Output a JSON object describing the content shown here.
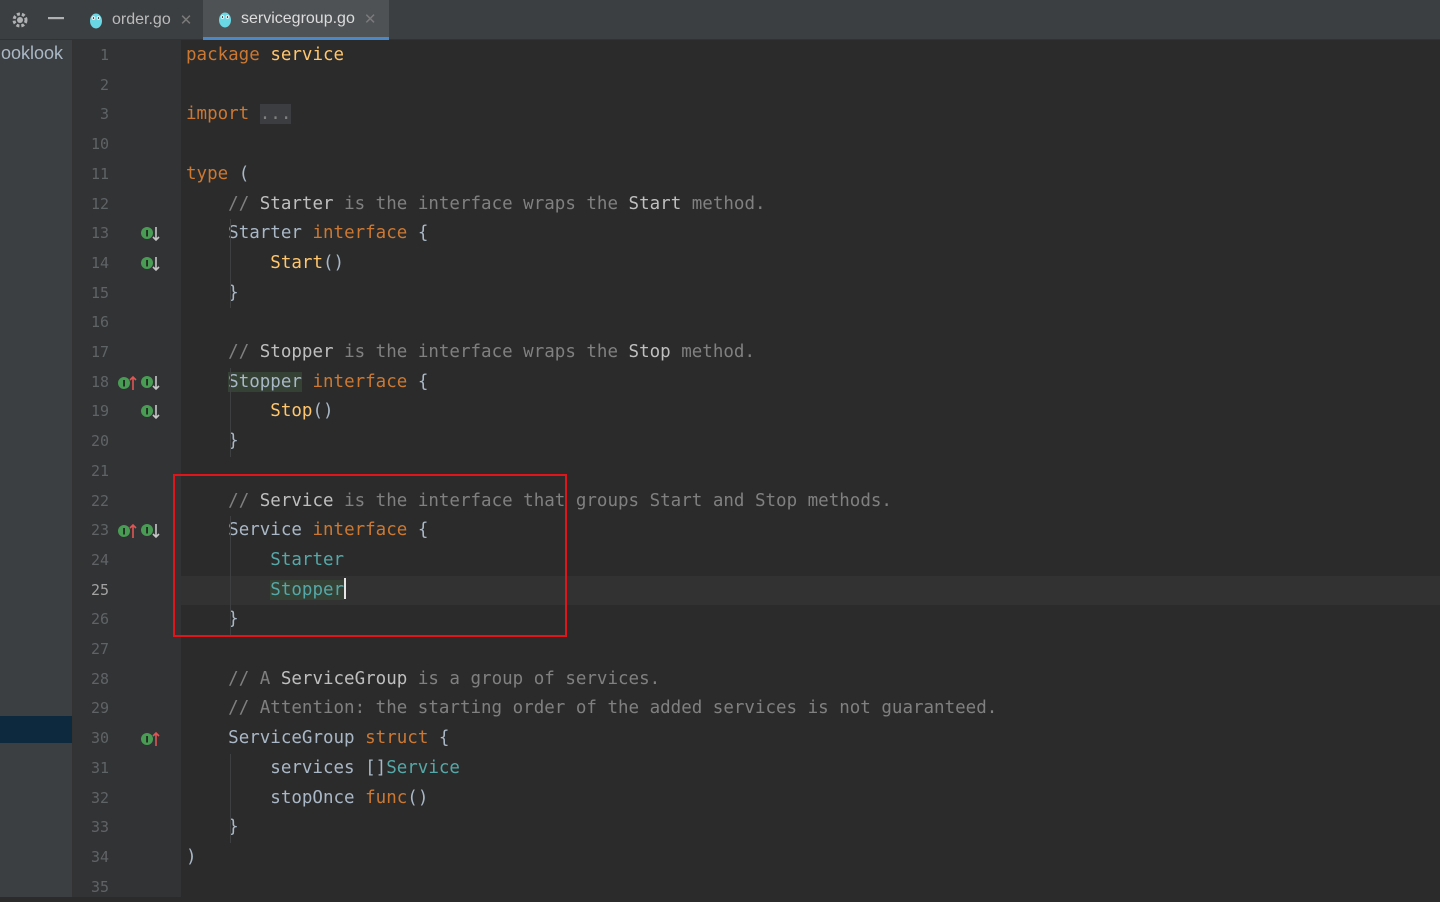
{
  "tabs": [
    {
      "label": "order.go",
      "active": false
    },
    {
      "label": "servicegroup.go",
      "active": true
    }
  ],
  "toolbar": {
    "gear_icon": "gear-icon",
    "minimize_icon": "minimize-icon"
  },
  "project_panel": {
    "visible_text": "ooklook"
  },
  "colors": {
    "keyword": "#cc7832",
    "comment": "#808080",
    "identifier": "#a9b7c6",
    "function": "#ffc66d",
    "type_ref": "#56a8a8",
    "highlight_box": "#e0141b",
    "current_line": "#323232"
  },
  "editor": {
    "current_line": 25,
    "lines": [
      {
        "num": "1",
        "tokens": [
          [
            "package",
            "kw"
          ],
          [
            " ",
            "pl"
          ],
          [
            "service",
            "fn"
          ]
        ]
      },
      {
        "num": "2",
        "tokens": []
      },
      {
        "num": "3",
        "tokens": [
          [
            "import",
            "kw"
          ],
          [
            " ",
            "pl"
          ],
          [
            "...",
            "fold"
          ]
        ]
      },
      {
        "num": "10",
        "tokens": []
      },
      {
        "num": "11",
        "tokens": [
          [
            "type",
            "kw"
          ],
          [
            " (",
            "pl"
          ]
        ]
      },
      {
        "num": "12",
        "tokens": [
          [
            "    ",
            "pl"
          ],
          [
            "// ",
            "cm"
          ],
          [
            "Starter",
            "cmb"
          ],
          [
            " is the interface wraps the ",
            "cm"
          ],
          [
            "Start",
            "cmb"
          ],
          [
            " method.",
            "cm"
          ]
        ]
      },
      {
        "num": "13",
        "marks": [
          "implemented"
        ],
        "tokens": [
          [
            "    ",
            "pl"
          ],
          [
            "Starter",
            "id"
          ],
          [
            " ",
            "pl"
          ],
          [
            "interface",
            "kw"
          ],
          [
            " {",
            "pl"
          ]
        ]
      },
      {
        "num": "14",
        "marks": [
          "implemented"
        ],
        "tokens": [
          [
            "        ",
            "pl"
          ],
          [
            "Start",
            "fn"
          ],
          [
            "()",
            "pl"
          ]
        ]
      },
      {
        "num": "15",
        "tokens": [
          [
            "    }",
            "pl"
          ]
        ]
      },
      {
        "num": "16",
        "tokens": []
      },
      {
        "num": "17",
        "tokens": [
          [
            "    ",
            "pl"
          ],
          [
            "// ",
            "cm"
          ],
          [
            "Stopper",
            "cmb"
          ],
          [
            " is the interface wraps the ",
            "cm"
          ],
          [
            "Stop",
            "cmb"
          ],
          [
            " method.",
            "cm"
          ]
        ]
      },
      {
        "num": "18",
        "marks": [
          "implements",
          "implemented"
        ],
        "tokens": [
          [
            "    ",
            "pl"
          ],
          [
            "Stopper",
            "hl"
          ],
          [
            " ",
            "pl"
          ],
          [
            "interface",
            "kw"
          ],
          [
            " {",
            "pl"
          ]
        ]
      },
      {
        "num": "19",
        "marks": [
          "implemented"
        ],
        "tokens": [
          [
            "        ",
            "pl"
          ],
          [
            "Stop",
            "fn"
          ],
          [
            "()",
            "pl"
          ]
        ]
      },
      {
        "num": "20",
        "tokens": [
          [
            "    }",
            "pl"
          ]
        ]
      },
      {
        "num": "21",
        "tokens": []
      },
      {
        "num": "22",
        "tokens": [
          [
            "    ",
            "pl"
          ],
          [
            "// ",
            "cm"
          ],
          [
            "Service",
            "cmb"
          ],
          [
            " is the interface that groups Start and Stop methods.",
            "cm"
          ]
        ]
      },
      {
        "num": "23",
        "marks": [
          "implements",
          "implemented"
        ],
        "tokens": [
          [
            "    ",
            "pl"
          ],
          [
            "Service",
            "id"
          ],
          [
            " ",
            "pl"
          ],
          [
            "interface",
            "kw"
          ],
          [
            " {",
            "pl"
          ]
        ]
      },
      {
        "num": "24",
        "tokens": [
          [
            "        ",
            "pl"
          ],
          [
            "Starter",
            "ty"
          ]
        ]
      },
      {
        "num": "25",
        "caret": true,
        "tokens": [
          [
            "        ",
            "pl"
          ],
          [
            "Stopper",
            "tyhl"
          ]
        ]
      },
      {
        "num": "26",
        "tokens": [
          [
            "    }",
            "pl"
          ]
        ]
      },
      {
        "num": "27",
        "tokens": []
      },
      {
        "num": "28",
        "tokens": [
          [
            "    ",
            "pl"
          ],
          [
            "// A ",
            "cm"
          ],
          [
            "ServiceGroup",
            "cmb"
          ],
          [
            " is a group of services.",
            "cm"
          ]
        ]
      },
      {
        "num": "29",
        "tokens": [
          [
            "    ",
            "pl"
          ],
          [
            "// Attention: the starting order of the added services is not guaranteed.",
            "cm"
          ]
        ]
      },
      {
        "num": "30",
        "marks": [
          "implements"
        ],
        "tokens": [
          [
            "    ",
            "pl"
          ],
          [
            "ServiceGroup",
            "id"
          ],
          [
            " ",
            "pl"
          ],
          [
            "struct",
            "kw"
          ],
          [
            " {",
            "pl"
          ]
        ]
      },
      {
        "num": "31",
        "tokens": [
          [
            "        services []",
            "pl"
          ],
          [
            "Service",
            "ty"
          ]
        ]
      },
      {
        "num": "32",
        "tokens": [
          [
            "        stopOnce ",
            "pl"
          ],
          [
            "func",
            "kw"
          ],
          [
            "()",
            "pl"
          ]
        ]
      },
      {
        "num": "33",
        "tokens": [
          [
            "    }",
            "pl"
          ]
        ]
      },
      {
        "num": "34",
        "tokens": [
          [
            ")",
            "pl"
          ]
        ]
      },
      {
        "num": "35",
        "tokens": []
      }
    ]
  }
}
